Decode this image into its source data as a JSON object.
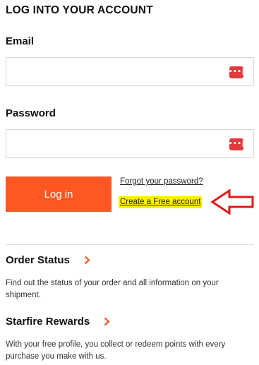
{
  "page": {
    "title": "LOG INTO YOUR ACCOUNT"
  },
  "form": {
    "email_label": "Email",
    "email_value": "",
    "password_label": "Password",
    "password_value": "",
    "password_manager_icon": "password-manager-icon",
    "login_button": "Log in",
    "forgot_link": "Forgot your password?",
    "create_account_link": "Create a Free account"
  },
  "annotation": {
    "arrow_color": "#e11818",
    "highlight_color": "#ffef00"
  },
  "sections": [
    {
      "title": "Order Status",
      "text": "Find out the status of your order and all information on your shipment."
    },
    {
      "title": "Starfire Rewards",
      "text": "With your free profile, you collect or redeem points with every purchase you make with us."
    }
  ],
  "colors": {
    "accent": "#ff5722",
    "chevron": "#ff5722",
    "icon_red": "#e03a3a"
  }
}
